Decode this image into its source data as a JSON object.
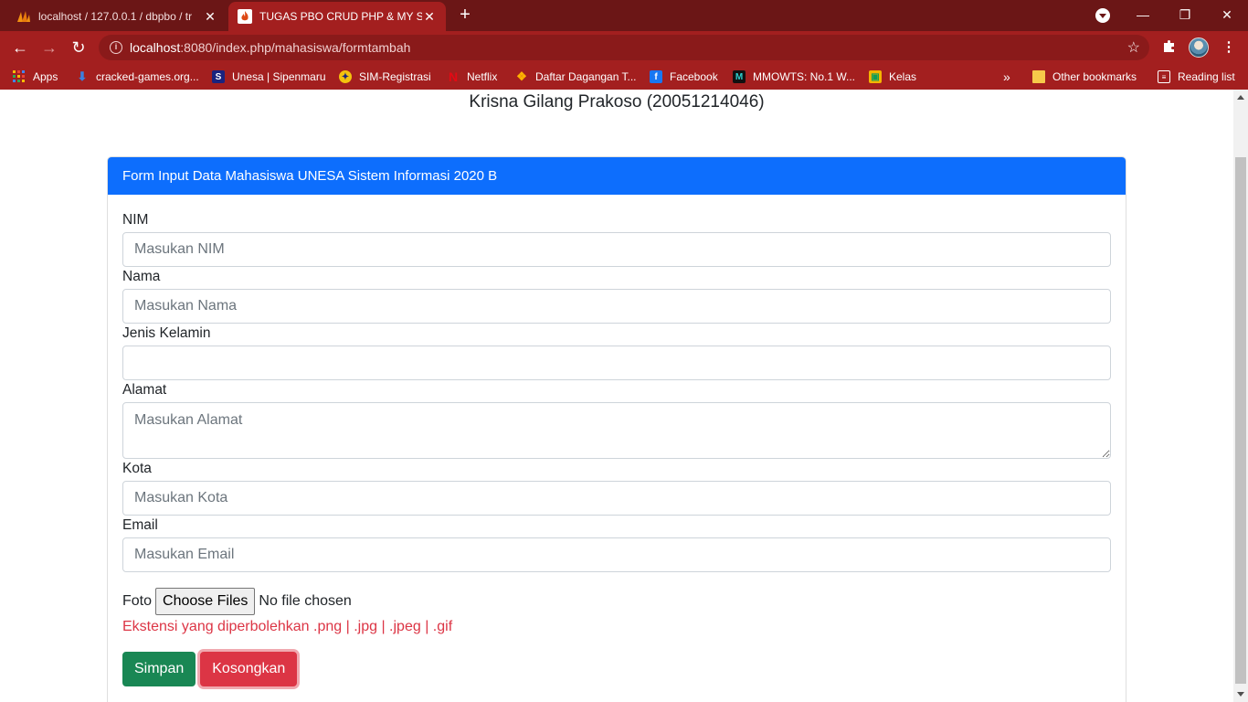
{
  "browser": {
    "tabs": [
      {
        "title": "localhost / 127.0.0.1 / dbpbo / tr",
        "active": false
      },
      {
        "title": "TUGAS PBO CRUD PHP & MY SQ",
        "active": true
      }
    ],
    "url": {
      "host": "localhost",
      "rest": ":8080/index.php/mahasiswa/formtambah"
    },
    "bookmarks": [
      {
        "label": "Apps",
        "icon": "apps-grid-icon"
      },
      {
        "label": "cracked-games.org...",
        "icon": "download-arrow-icon"
      },
      {
        "label": "Unesa | Sipenmaru",
        "icon": "unesa-s-icon"
      },
      {
        "label": "SIM-Registrasi",
        "icon": "unesa-emblem-icon"
      },
      {
        "label": "Netflix",
        "icon": "netflix-icon"
      },
      {
        "label": "Daftar Dagangan T...",
        "icon": "dagangan-icon"
      },
      {
        "label": "Facebook",
        "icon": "facebook-icon"
      },
      {
        "label": "MMOWTS: No.1 W...",
        "icon": "mmowts-icon"
      },
      {
        "label": "Kelas",
        "icon": "classroom-icon"
      }
    ],
    "overflow_label": "»",
    "other_bookmarks": "Other bookmarks",
    "reading_list": "Reading list"
  },
  "page": {
    "heading": "Krisna Gilang Prakoso (20051214046)",
    "form": {
      "title": "Form Input Data Mahasiswa UNESA Sistem Informasi 2020 B",
      "fields": {
        "nim": {
          "label": "NIM",
          "placeholder": "Masukan NIM"
        },
        "nama": {
          "label": "Nama",
          "placeholder": "Masukan Nama"
        },
        "jenis_kelamin": {
          "label": "Jenis Kelamin",
          "placeholder": ""
        },
        "alamat": {
          "label": "Alamat",
          "placeholder": "Masukan Alamat"
        },
        "kota": {
          "label": "Kota",
          "placeholder": "Masukan Kota"
        },
        "email": {
          "label": "Email",
          "placeholder": "Masukan Email"
        }
      },
      "foto": {
        "label": "Foto",
        "button": "Choose Files",
        "status": "No file chosen",
        "hint": "Ekstensi yang diperbolehkan .png | .jpg | .jpeg | .gif"
      },
      "buttons": {
        "save": "Simpan",
        "reset": "Kosongkan"
      }
    }
  },
  "colors": {
    "header_blue": "#0d6efd",
    "save_green": "#198754",
    "reset_red": "#dc3545",
    "chrome_red": "#a31f1f"
  }
}
